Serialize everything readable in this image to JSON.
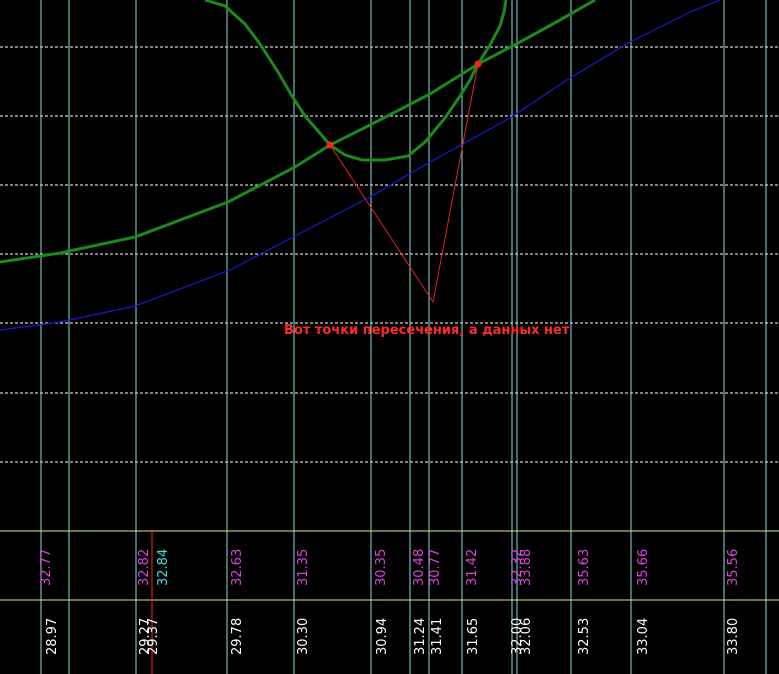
{
  "colors": {
    "background": "#000000",
    "grid_h": "#ffffff",
    "grid_v": "#7fe0e0",
    "table_line": "#e8e874",
    "green_curve": "#1b8a1b",
    "blue_line": "#1a1ad0",
    "red_marker": "#ff2020",
    "annotation_text": "#ff2a2a",
    "top_value": "#e040e0",
    "top_value_alt": "#40e0e0",
    "bottom_value": "#ffffff"
  },
  "annotation": {
    "text": "Вот точки пересечения, а данных нет"
  },
  "top_row_values": [
    {
      "id": "t1",
      "text": "32.77",
      "color": "top_value"
    },
    {
      "id": "t2",
      "text": "32.82",
      "color": "top_value"
    },
    {
      "id": "t3",
      "text": "32.84",
      "color": "top_value_alt"
    },
    {
      "id": "t4",
      "text": "32.63",
      "color": "top_value"
    },
    {
      "id": "t5",
      "text": "31.35",
      "color": "top_value"
    },
    {
      "id": "t6",
      "text": "30.35",
      "color": "top_value"
    },
    {
      "id": "t7",
      "text": "30.48",
      "color": "top_value"
    },
    {
      "id": "t8",
      "text": "30.77",
      "color": "top_value"
    },
    {
      "id": "t9",
      "text": "31.42",
      "color": "top_value"
    },
    {
      "id": "t10",
      "text": "32.32",
      "color": "top_value"
    },
    {
      "id": "t11",
      "text": "33.88",
      "color": "top_value"
    },
    {
      "id": "t12",
      "text": "35.63",
      "color": "top_value"
    },
    {
      "id": "t13",
      "text": "35.66",
      "color": "top_value"
    },
    {
      "id": "t14",
      "text": "35.56",
      "color": "top_value"
    }
  ],
  "bottom_row_values": [
    {
      "id": "b1",
      "text": "28.97"
    },
    {
      "id": "b2",
      "text": "29.27"
    },
    {
      "id": "b3",
      "text": "29.37"
    },
    {
      "id": "b4",
      "text": "29.78"
    },
    {
      "id": "b5",
      "text": "30.30"
    },
    {
      "id": "b6",
      "text": "30.94"
    },
    {
      "id": "b7",
      "text": "31.24"
    },
    {
      "id": "b8",
      "text": "31.41"
    },
    {
      "id": "b9",
      "text": "31.65"
    },
    {
      "id": "b10",
      "text": "32.00"
    },
    {
      "id": "b11",
      "text": "32.06"
    },
    {
      "id": "b12",
      "text": "32.53"
    },
    {
      "id": "b13",
      "text": "33.04"
    },
    {
      "id": "b14",
      "text": "33.80"
    }
  ]
}
